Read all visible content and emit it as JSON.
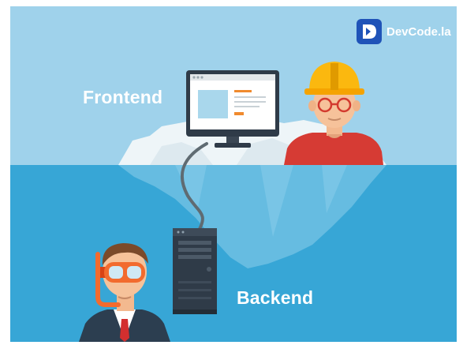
{
  "brand": {
    "name": "DevCode.la",
    "logo_color": "#1f53b8",
    "icon": "devcode-logo-icon"
  },
  "labels": {
    "frontend": "Frontend",
    "backend": "Backend"
  },
  "colors": {
    "sky": "#9fd2eb",
    "water": "#37a6d6",
    "iceberg": "#eef5f8",
    "helmet": "#fbb80f",
    "shirt_red": "#d63b34",
    "suit": "#2c3e50",
    "tie": "#d32f2f"
  }
}
